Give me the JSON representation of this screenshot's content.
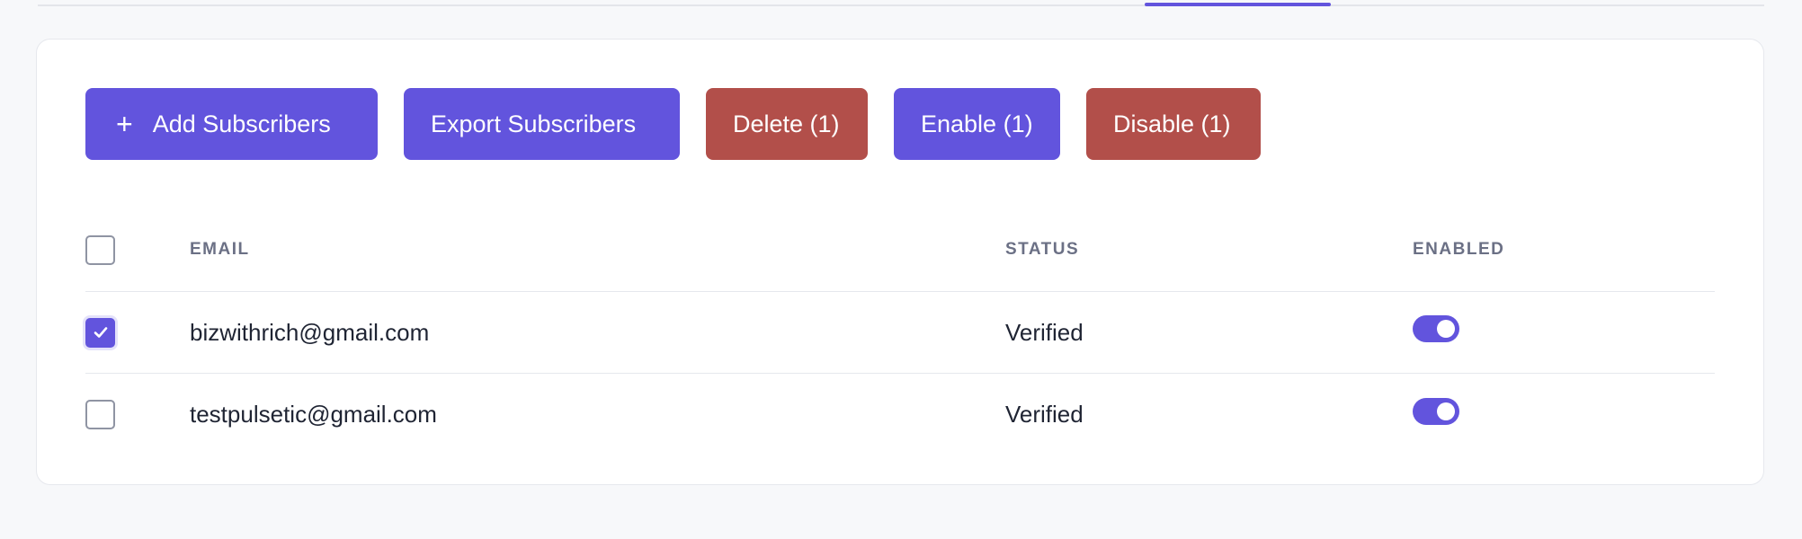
{
  "colors": {
    "primary": "#6254dd",
    "danger": "#b24f4a",
    "text": "#1f2433",
    "muted": "#6b7085"
  },
  "toolbar": {
    "add_icon": "plus-icon",
    "add_label": "Add Subscribers",
    "export_label": "Export Subscribers",
    "delete_label": "Delete (1)",
    "enable_label": "Enable (1)",
    "disable_label": "Disable (1)"
  },
  "table": {
    "headers": {
      "email": "EMAIL",
      "status": "STATUS",
      "enabled": "ENABLED"
    },
    "rows": [
      {
        "selected": true,
        "email": "bizwithrich@gmail.com",
        "status": "Verified",
        "enabled": true
      },
      {
        "selected": false,
        "email": "testpulsetic@gmail.com",
        "status": "Verified",
        "enabled": true
      }
    ]
  }
}
